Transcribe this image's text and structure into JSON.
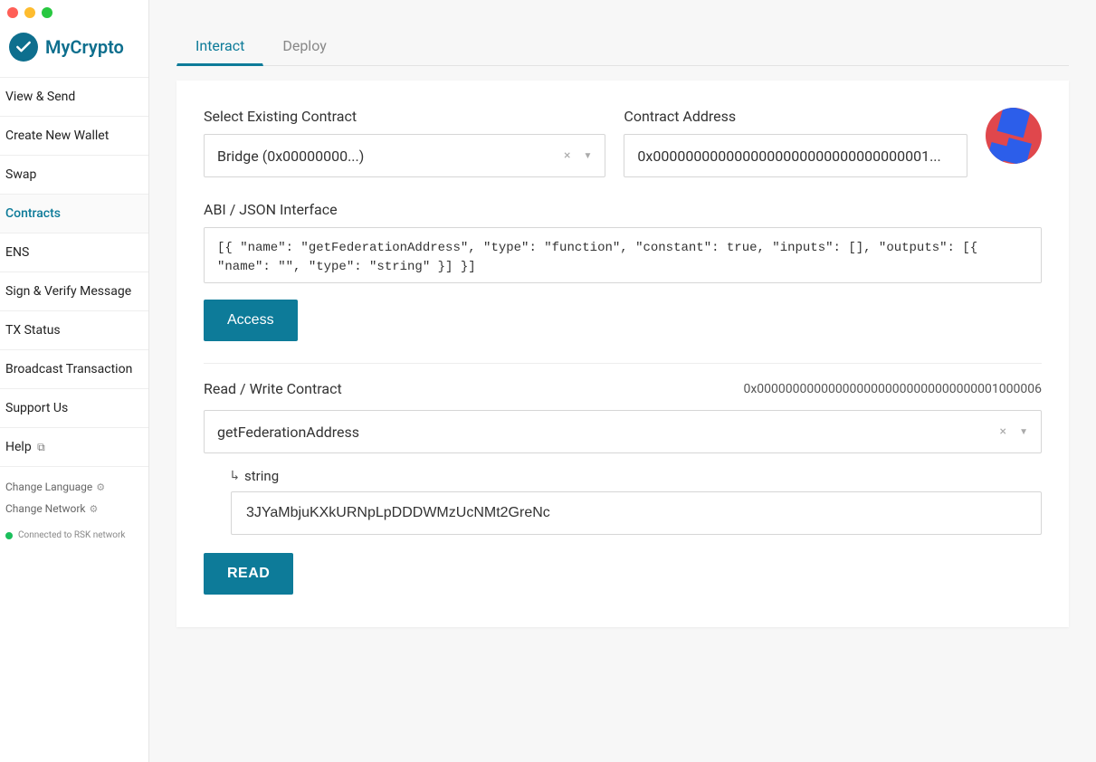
{
  "branding": {
    "name": "MyCrypto"
  },
  "sidebar": {
    "items": [
      {
        "label": "View & Send"
      },
      {
        "label": "Create New Wallet"
      },
      {
        "label": "Swap"
      },
      {
        "label": "Contracts"
      },
      {
        "label": "ENS"
      },
      {
        "label": "Sign & Verify Message"
      },
      {
        "label": "TX Status"
      },
      {
        "label": "Broadcast Transaction"
      },
      {
        "label": "Support Us"
      },
      {
        "label": "Help"
      }
    ],
    "change_language": "Change Language",
    "change_network": "Change Network",
    "network_status": "Connected to RSK network"
  },
  "tabs": {
    "interact": "Interact",
    "deploy": "Deploy"
  },
  "contract": {
    "select_label": "Select Existing Contract",
    "select_value": "Bridge (0x00000000...)",
    "address_label": "Contract Address",
    "address_value": "0x0000000000000000000000000000000001...",
    "full_address": "0x0000000000000000000000000000000001000006",
    "abi_label": "ABI / JSON Interface",
    "abi_value": "[{ \"name\": \"getFederationAddress\", \"type\": \"function\", \"constant\": true, \"inputs\": [], \"outputs\": [{ \"name\": \"\", \"type\": \"string\" }] }]",
    "access_btn": "Access",
    "rw_label": "Read / Write Contract",
    "method_value": "getFederationAddress",
    "output_type": "string",
    "output_value": "3JYaMbjuKXkURNpLpDDDWMzUcNMt2GreNc",
    "read_btn": "READ"
  }
}
